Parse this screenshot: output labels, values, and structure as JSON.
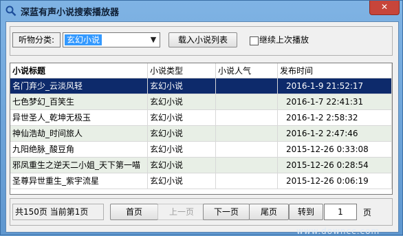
{
  "window": {
    "title": "深蓝有声小说搜索播放器",
    "close_label": "✕"
  },
  "toolbar": {
    "category_label": "听物分类:",
    "category_value": "玄幻小说",
    "load_button": "载入小说列表",
    "continue_checkbox_label": "继续上次播放",
    "continue_checked": false
  },
  "table": {
    "headers": [
      "小说标题",
      "小说类型",
      "小说人气",
      "发布时间"
    ],
    "rows": [
      {
        "title": "名门弃少_云淡风轻",
        "type": "玄幻小说",
        "popularity": "",
        "time": "2016-1-9 21:52:17"
      },
      {
        "title": "七色梦幻_百笑生",
        "type": "玄幻小说",
        "popularity": "",
        "time": "2016-1-7 22:41:31"
      },
      {
        "title": "异世圣人_乾坤无极玉",
        "type": "玄幻小说",
        "popularity": "",
        "time": "2016-1-2 2:58:32"
      },
      {
        "title": "神仙浩劫_时间旅人",
        "type": "玄幻小说",
        "popularity": "",
        "time": "2016-1-2 2:47:46"
      },
      {
        "title": "九阳绝脉_酸豆角",
        "type": "玄幻小说",
        "popularity": "",
        "time": "2015-12-26 0:33:08"
      },
      {
        "title": "邪凤重生之逆天二小姐_天下第一喵",
        "type": "玄幻小说",
        "popularity": "",
        "time": "2015-12-26 0:28:54"
      },
      {
        "title": "圣尊异世重生_紫宇流星",
        "type": "玄幻小说",
        "popularity": "",
        "time": "2015-12-26 0:06:19"
      }
    ]
  },
  "pager": {
    "info": "共150页  当前第1页",
    "first": "首页",
    "prev": "上一页",
    "next": "下一页",
    "last": "尾页",
    "goto": "转到",
    "page_value": "1",
    "page_suffix": "页"
  },
  "watermark": "www.downcc.com",
  "colors": {
    "selected_row": "#0d2a6b",
    "alt_row": "#e8efe6",
    "title_bar": "#6fa6d9"
  }
}
